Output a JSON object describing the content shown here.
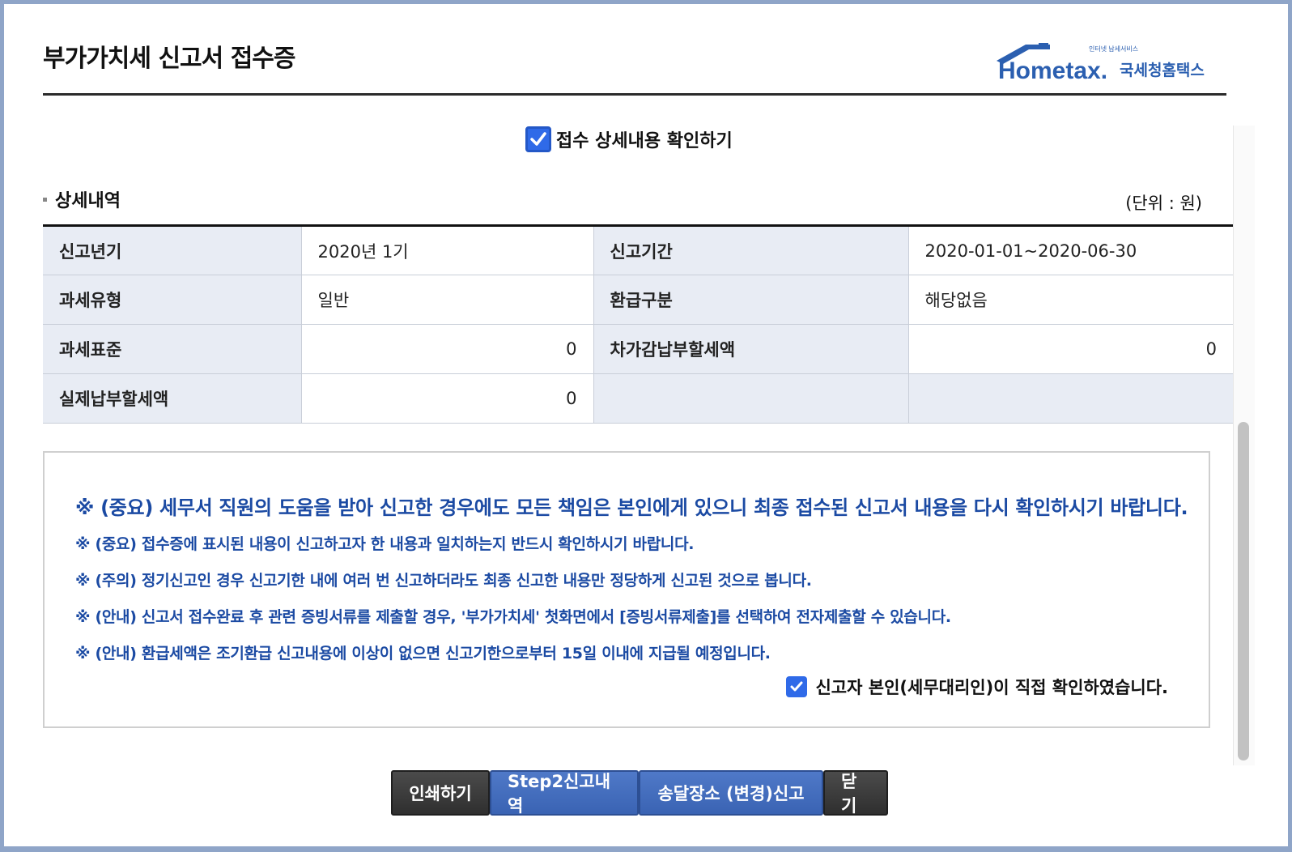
{
  "header": {
    "title": "부가가치세 신고서 접수증",
    "logo": {
      "small_text": "인터넷 납세서비스",
      "brand": "Hometax.",
      "korean": "국세청홈택스"
    }
  },
  "confirm_detail": {
    "checked": true,
    "label": "접수 상세내용 확인하기"
  },
  "details": {
    "section_title": "상세내역",
    "unit": "(단위 : 원)",
    "rows": [
      {
        "label1": "신고년기",
        "value1": "2020년 1기",
        "label2": "신고기간",
        "value2": "2020-01-01~2020-06-30"
      },
      {
        "label1": "과세유형",
        "value1": "일반",
        "label2": "환급구분",
        "value2": "해당없음"
      },
      {
        "label1": "과세표준",
        "value1": "0",
        "label2": "차가감납부할세액",
        "value2": "0"
      },
      {
        "label1": "실제납부할세액",
        "value1": "0",
        "label2": "",
        "value2": ""
      }
    ]
  },
  "notices": {
    "lines": [
      "※ (중요) 세무서 직원의 도움을 받아 신고한 경우에도 모든 책임은 본인에게 있으니 최종 접수된 신고서 내용을 다시 확인하시기 바랍니다.",
      "※ (중요) 접수증에 표시된 내용이 신고하고자 한 내용과 일치하는지 반드시 확인하시기 바랍니다.",
      "※ (주의) 정기신고인 경우 신고기한 내에 여러 번 신고하더라도 최종 신고한 내용만 정당하게 신고된 것으로 봅니다.",
      "※ (안내) 신고서 접수완료 후 관련 증빙서류를 제출할 경우, '부가가치세' 첫화면에서 [증빙서류제출]를 선택하여 전자제출할 수 있습니다.",
      "※ (안내) 환급세액은 조기환급 신고내용에 이상이 없으면 신고기한으로부터 15일 이내에 지급될 예정입니다."
    ],
    "confirm": {
      "checked": true,
      "label": "신고자 본인(세무대리인)이 직접 확인하였습니다."
    }
  },
  "buttons": {
    "print": "인쇄하기",
    "step2": "Step2신고내역",
    "delivery": "송달장소 (변경)신고",
    "close": "닫기"
  },
  "colors": {
    "frame": "#8fa5c8",
    "notice_text": "#1b4aa3",
    "header_cell": "#e8ecf4",
    "button_dark": "#3a3a3a",
    "button_blue": "#4670be",
    "checkbox": "#2f6ae8"
  },
  "icons": {
    "check": "check-mark-icon",
    "logo_roof": "house-roof-icon"
  }
}
